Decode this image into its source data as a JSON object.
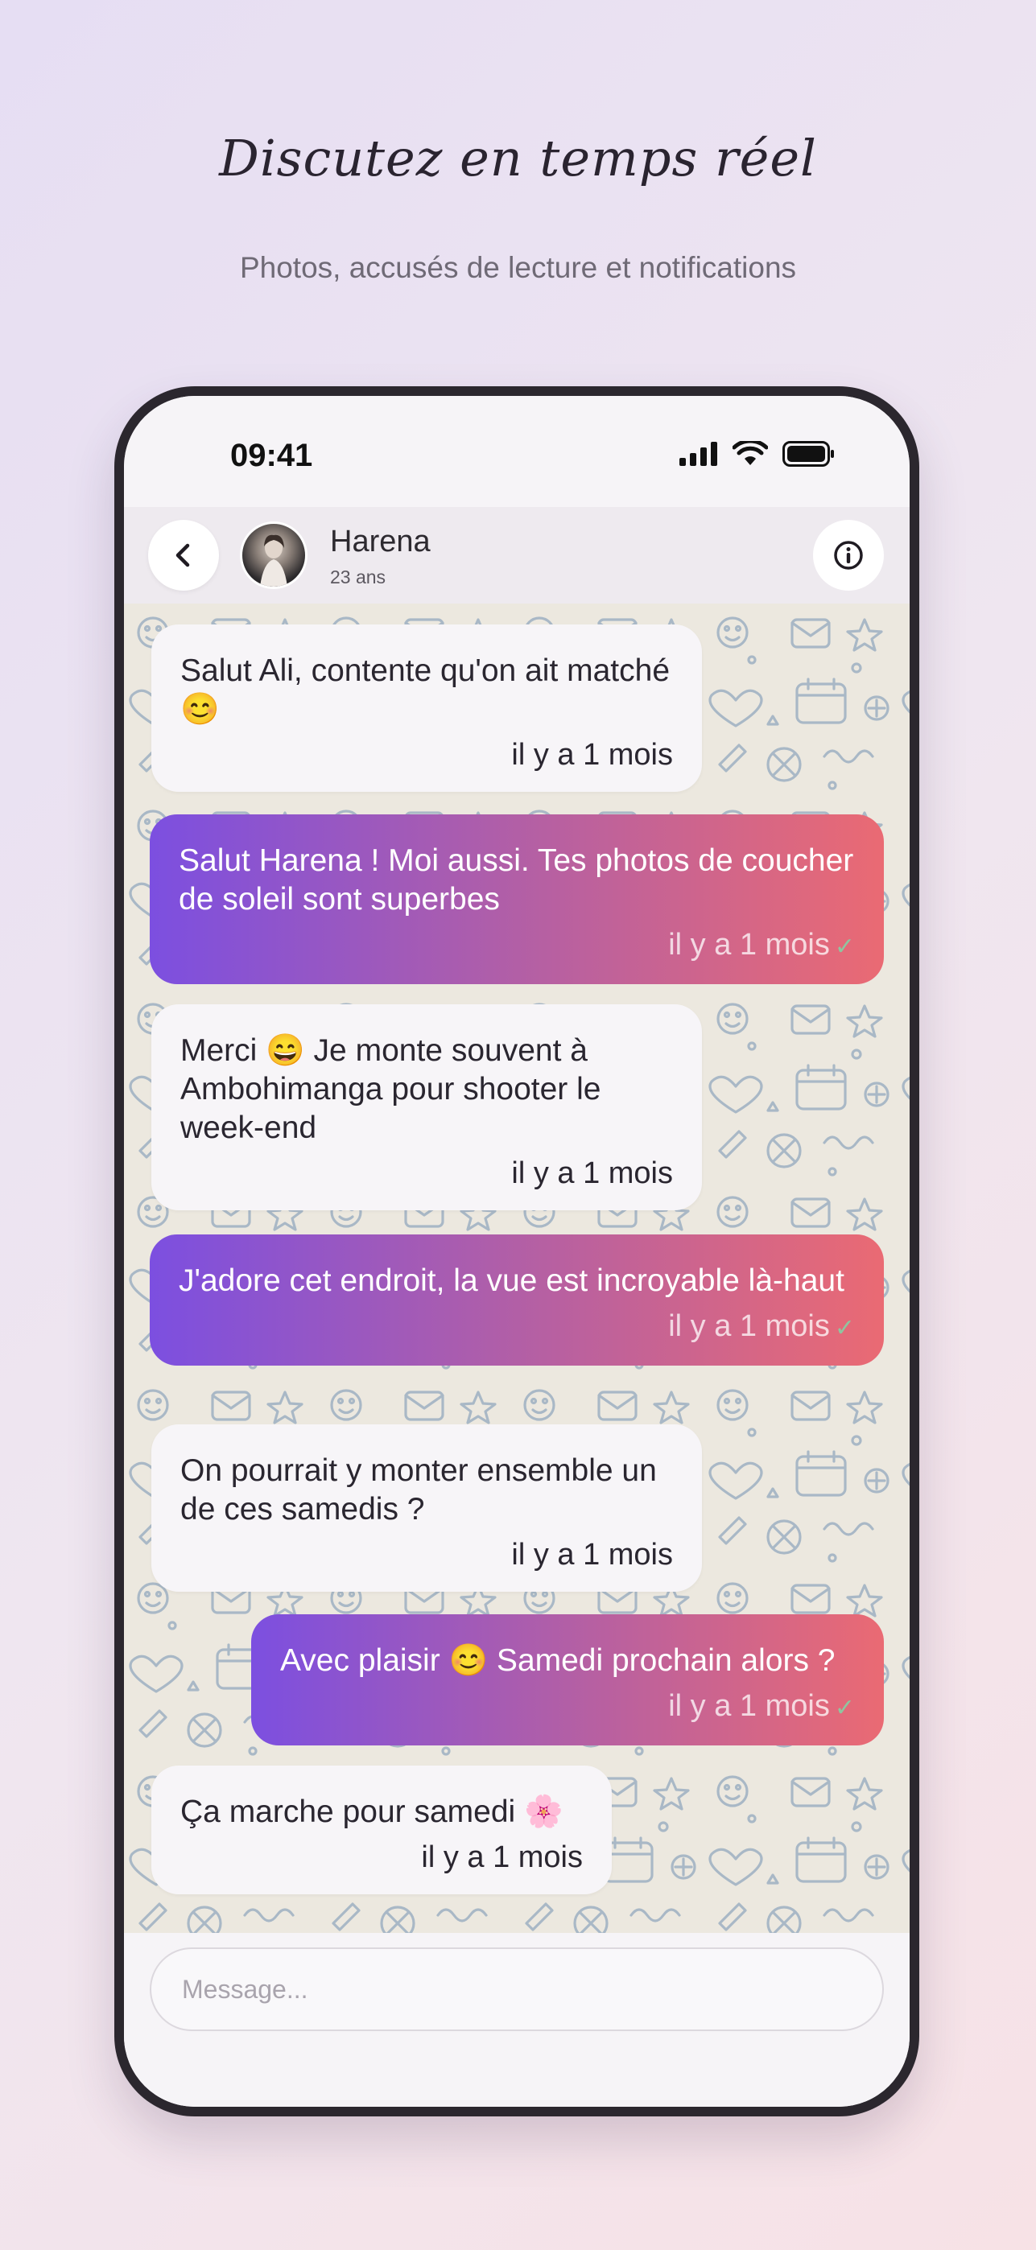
{
  "promo": {
    "headline": "Discutez en temps réel",
    "subline": "Photos, accusés de lecture et notifications"
  },
  "status_bar": {
    "time": "09:41"
  },
  "header": {
    "contact_name": "Harena",
    "contact_age": "23 ans",
    "back_icon": "chevron-left-icon",
    "info_icon": "info-circle-icon"
  },
  "messages": [
    {
      "direction": "received",
      "text": "Salut Ali, contente qu'on ait matché 😊",
      "time": "il y a 1 mois"
    },
    {
      "direction": "sent",
      "text": "Salut Harena ! Moi aussi. Tes photos de coucher de soleil sont superbes",
      "time": "il y a 1 mois",
      "status": "✓"
    },
    {
      "direction": "received",
      "text": "Merci 😄 Je monte souvent à Ambohimanga pour shooter le week-end",
      "time": "il y a 1 mois"
    },
    {
      "direction": "sent",
      "text": "J'adore cet endroit, la vue est incroyable là-haut",
      "time": "il y a 1 mois",
      "status": "✓"
    },
    {
      "direction": "received",
      "text": "On pourrait y monter ensemble un de ces samedis ?",
      "time": "il y a 1 mois"
    },
    {
      "direction": "sent",
      "text": "Avec plaisir 😊 Samedi prochain alors ?",
      "time": "il y a 1 mois",
      "status": "✓"
    },
    {
      "direction": "received",
      "text": "Ça marche pour samedi 🌸",
      "time": "il y a 1 mois"
    }
  ],
  "composer": {
    "placeholder": "Message..."
  },
  "colors": {
    "sent_gradient_start": "#7c4fe0",
    "sent_gradient_end": "#ea6a73",
    "read_tick": "#8fc5a0",
    "chat_background": "#ece8df"
  }
}
